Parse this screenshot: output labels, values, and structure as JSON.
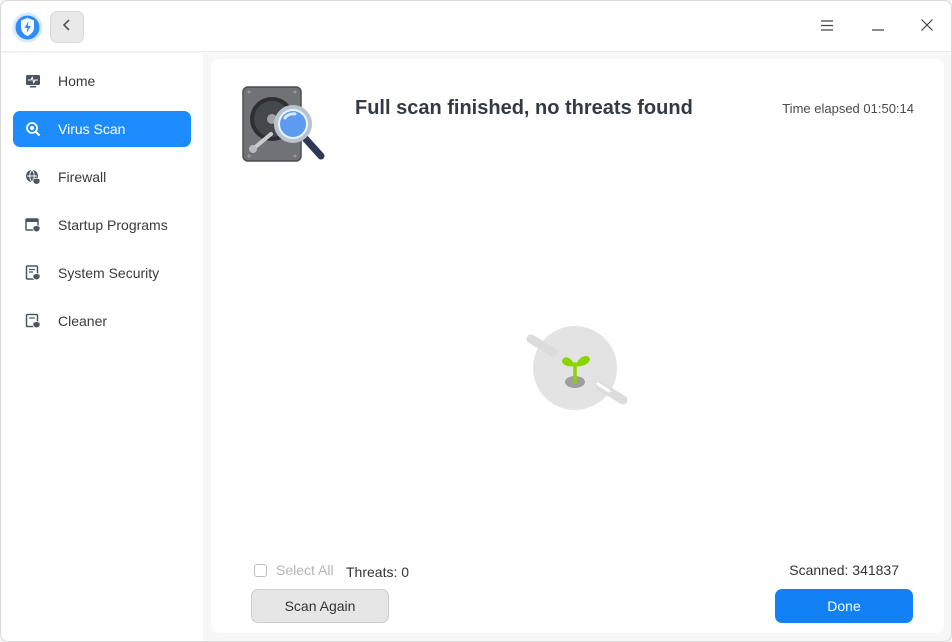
{
  "titlebar": {
    "app_icon": "shield-lightning-icon",
    "back_icon": "chevron-left-icon",
    "menu_icon": "hamburger-menu-icon",
    "minimize_icon": "minimize-icon",
    "close_icon": "close-icon"
  },
  "sidebar": {
    "items": [
      {
        "label": "Home",
        "icon": "monitor-pulse-icon",
        "active": false
      },
      {
        "label": "Virus Scan",
        "icon": "magnifier-scan-icon",
        "active": true
      },
      {
        "label": "Firewall",
        "icon": "globe-shield-icon",
        "active": false
      },
      {
        "label": "Startup Programs",
        "icon": "window-shield-icon",
        "active": false
      },
      {
        "label": "System Security",
        "icon": "document-shield-icon",
        "active": false
      },
      {
        "label": "Cleaner",
        "icon": "broom-shield-icon",
        "active": false
      }
    ]
  },
  "main": {
    "header_icon": "hard-drive-magnifier-icon",
    "title": "Full scan finished, no threats found",
    "elapsed": "Time elapsed 01:50:14",
    "empty_icon": "sprout-icon",
    "select_all": "Select All",
    "threats": "Threats: 0",
    "scanned": "Scanned: 341837",
    "scan_again_label": "Scan Again",
    "done_label": "Done"
  },
  "colors": {
    "accent": "#1d8cff",
    "done_button": "#1281f5",
    "sprout": "#8ad400"
  }
}
